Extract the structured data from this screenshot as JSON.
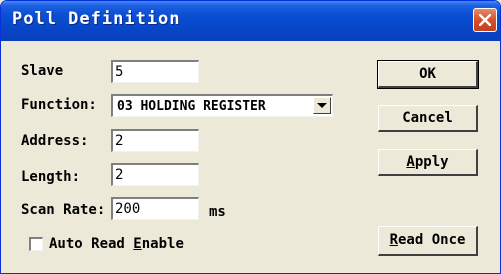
{
  "window": {
    "title": "Poll Definition"
  },
  "form": {
    "slave": {
      "label": "Slave",
      "value": "5"
    },
    "function": {
      "label": "Function:",
      "value": "03 HOLDING REGISTER"
    },
    "address": {
      "label": "Address:",
      "value": "2"
    },
    "length": {
      "label": "Length:",
      "value": "2"
    },
    "scan_rate": {
      "label": "Scan Rate:",
      "value": "200",
      "unit": "ms"
    },
    "auto_read": {
      "label_pre": "Auto Read ",
      "label_key": "E",
      "label_post": "nable",
      "checked": false
    }
  },
  "buttons": {
    "ok": "OK",
    "cancel": "Cancel",
    "apply_key": "A",
    "apply_rest": "pply",
    "read_once_key": "R",
    "read_once_rest": "ead Once"
  },
  "icons": {
    "close": "close-icon",
    "dropdown": "chevron-down-icon"
  },
  "colors": {
    "titlebar": "#0a4fd4",
    "close": "#d7512c",
    "face": "#ece9d8"
  }
}
